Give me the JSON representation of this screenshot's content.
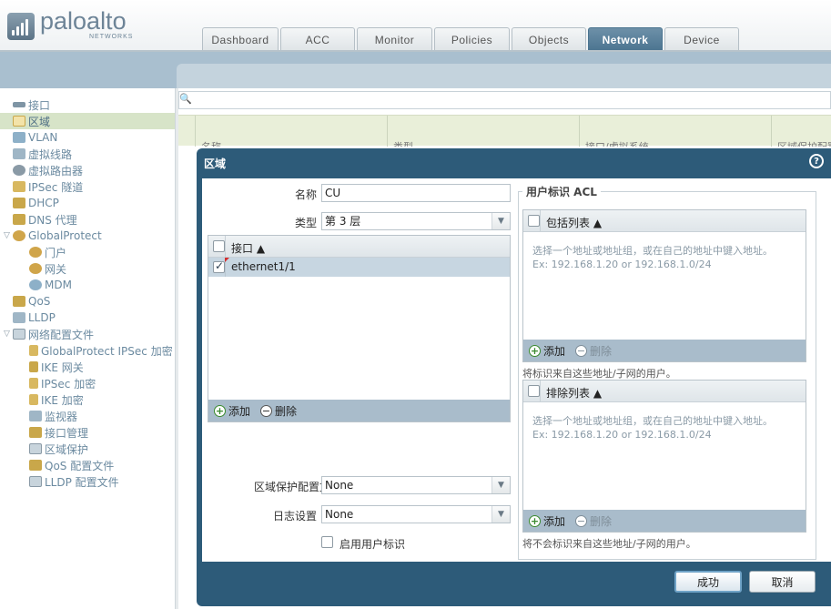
{
  "logo": {
    "text": "paloalto",
    "sub": "NETWORKS"
  },
  "tabs": [
    {
      "label": "Dashboard",
      "active": false
    },
    {
      "label": "ACC",
      "active": false
    },
    {
      "label": "Monitor",
      "active": false
    },
    {
      "label": "Policies",
      "active": false
    },
    {
      "label": "Objects",
      "active": false
    },
    {
      "label": "Network",
      "active": true
    },
    {
      "label": "Device",
      "active": false
    }
  ],
  "sidebar": {
    "items": [
      {
        "label": "接口",
        "icon": "interface-icon"
      },
      {
        "label": "区域",
        "icon": "zone-icon",
        "selected": true
      },
      {
        "label": "VLAN",
        "icon": "vlan-icon"
      },
      {
        "label": "虚拟线路",
        "icon": "virtual-wire-icon"
      },
      {
        "label": "虚拟路由器",
        "icon": "virtual-router-icon"
      },
      {
        "label": "IPSec 隧道",
        "icon": "ipsec-tunnel-icon"
      },
      {
        "label": "DHCP",
        "icon": "dhcp-icon"
      },
      {
        "label": "DNS 代理",
        "icon": "dns-proxy-icon"
      },
      {
        "label": "GlobalProtect",
        "icon": "globalprotect-icon",
        "expandable": true
      },
      {
        "label": "门户",
        "icon": "portal-icon"
      },
      {
        "label": "网关",
        "icon": "gateway-icon"
      },
      {
        "label": "MDM",
        "icon": "mdm-icon"
      },
      {
        "label": "QoS",
        "icon": "qos-icon"
      },
      {
        "label": "LLDP",
        "icon": "lldp-icon"
      },
      {
        "label": "网络配置文件",
        "icon": "network-profiles-icon",
        "expandable": true
      },
      {
        "label": "GlobalProtect IPSec 加密",
        "icon": "lock-icon"
      },
      {
        "label": "IKE 网关",
        "icon": "ike-gateway-icon"
      },
      {
        "label": "IPSec 加密",
        "icon": "lock-icon"
      },
      {
        "label": "IKE 加密",
        "icon": "lock-icon"
      },
      {
        "label": "监视器",
        "icon": "monitor-icon"
      },
      {
        "label": "接口管理",
        "icon": "interface-mgmt-icon"
      },
      {
        "label": "区域保护",
        "icon": "zone-protection-icon"
      },
      {
        "label": "QoS 配置文件",
        "icon": "qos-profile-icon"
      },
      {
        "label": "LLDP 配置文件",
        "icon": "lldp-profile-icon"
      }
    ]
  },
  "grid": {
    "columns": [
      "名称",
      "类型",
      "接口/虚拟系统",
      "区域保护配置"
    ]
  },
  "dialog": {
    "title": "区域",
    "help": "?",
    "name_label": "名称",
    "name_value": "CU",
    "type_label": "类型",
    "type_value": "第 3 层",
    "interfaces": {
      "header": "接口 ▲",
      "rows": [
        {
          "value": "ethernet1/1",
          "checked": true
        }
      ],
      "add": "添加",
      "delete": "删除"
    },
    "zone_protection_label": "区域保护配置文件",
    "zone_protection_value": "None",
    "log_label": "日志设置",
    "log_value": "None",
    "enable_userid_label": "启用用户标识",
    "userid_acl": {
      "legend": "用户标识 ACL",
      "include": {
        "header": "包括列表 ▲",
        "hint1": "选择一个地址或地址组，或在自己的地址中键入地址。",
        "hint2": "Ex: 192.168.1.20 or 192.168.1.0/24",
        "add": "添加",
        "delete": "删除",
        "note": "将标识来自这些地址/子网的用户。"
      },
      "exclude": {
        "header": "排除列表 ▲",
        "hint1": "选择一个地址或地址组，或在自己的地址中键入地址。",
        "hint2": "Ex: 192.168.1.20 or 192.168.1.0/24",
        "add": "添加",
        "delete": "删除",
        "note": "将不会标识来自这些地址/子网的用户。"
      }
    },
    "ok_label": "成功",
    "cancel_label": "取消"
  }
}
